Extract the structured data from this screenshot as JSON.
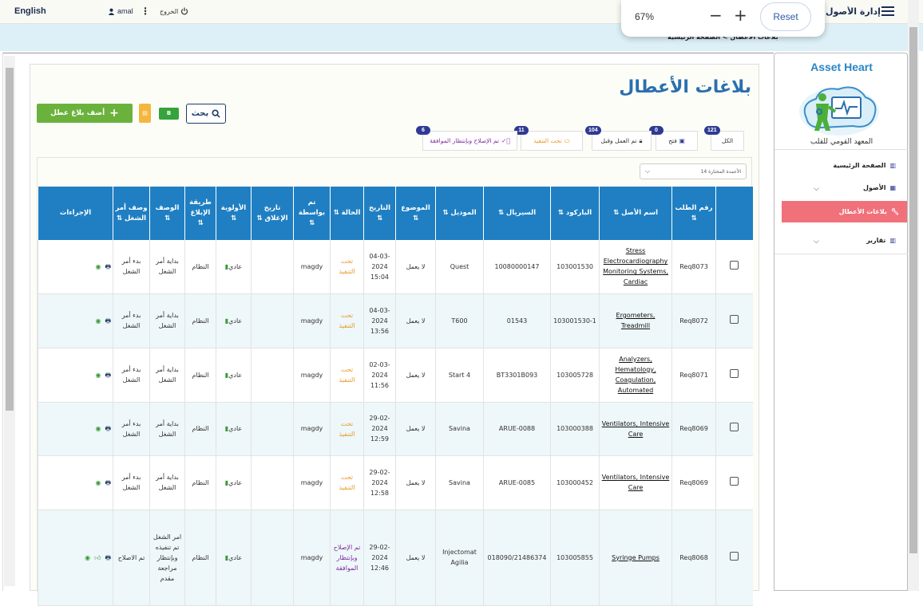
{
  "topbar": {
    "language": "English",
    "user": "amal",
    "logout": "الخروج",
    "system_name": "نظام إدارة الأصول"
  },
  "zoom": {
    "level": "67%",
    "reset": "Reset"
  },
  "breadcrumb": {
    "home": "الصفحة الرئيسية",
    "sep": ">",
    "current": "بلاغات الأعطال"
  },
  "page": {
    "title": "بلاغات الأعطال",
    "add_button": "أضف بلاغ عطل",
    "pdf_button": "",
    "excel_button": "B",
    "search_button": "بحث"
  },
  "filters": [
    {
      "label": "الكل",
      "count": "121"
    },
    {
      "label": "فتح",
      "count": "0"
    },
    {
      "label": "تم العمل وقبل",
      "count": "104"
    },
    {
      "label": "تحت التنفيذ",
      "count": "11"
    },
    {
      "label": "تم الإصلاح وبإنتظار الموافقة",
      "count": "6"
    }
  ],
  "column_selector": "14 الأعمدة المختارة",
  "table": {
    "headers": [
      "رقم الطلب ⇅",
      "اسم الأصل ⇅",
      "الباركود ⇅",
      "السيريال ⇅",
      "الموديل ⇅",
      "الموضوع ⇅",
      "التاريخ ⇅",
      "الحالة ⇅",
      "تم بواسطة ⇅",
      "تاريخ الإغلاق ⇅",
      "الأولوية ⇅",
      "طريقة الإبلاغ ⇅",
      "الوصف ⇅",
      "وصف أمر الشغل ⇅",
      "الإجراءات"
    ],
    "rows": [
      {
        "req": "Req8073",
        "asset": "Stress Electrocardiography Monitoring Systems, Cardiac",
        "barcode": "103001530",
        "serial": "10080000147",
        "model": "Quest",
        "subject": "لا يعمل",
        "date": "04-03-2024 15:04",
        "status": "تحت التنفيذ",
        "by": "magdy",
        "closed": "",
        "priority": "عادي",
        "method": "النظام",
        "desc": "بداية أمر الشغل",
        "wo_desc": "بدء أمر الشغل"
      },
      {
        "req": "Req8072",
        "asset": "Ergometers, Treadmill",
        "barcode": "103001530-1",
        "serial": "01543",
        "model": "T600",
        "subject": "لا يعمل",
        "date": "04-03-2024 13:56",
        "status": "تحت التنفيذ",
        "by": "magdy",
        "closed": "",
        "priority": "عادي",
        "method": "النظام",
        "desc": "بداية أمر الشغل",
        "wo_desc": "بدء أمر الشغل"
      },
      {
        "req": "Req8071",
        "asset": "Analyzers, Hematology, Coagulation, Automated",
        "barcode": "103005728",
        "serial": "BT3301B093",
        "model": "Start 4",
        "subject": "لا يعمل",
        "date": "02-03-2024 11:56",
        "status": "تحت التنفيذ",
        "by": "magdy",
        "closed": "",
        "priority": "عادي",
        "method": "النظام",
        "desc": "بداية أمر الشغل",
        "wo_desc": "بدء أمر الشغل"
      },
      {
        "req": "Req8069",
        "asset": "Ventilators, Intensive Care",
        "barcode": "103000388",
        "serial": "ARUE-0088",
        "model": "Savina",
        "subject": "لا يعمل",
        "date": "29-02-2024 12:59",
        "status": "تحت التنفيذ",
        "by": "magdy",
        "closed": "",
        "priority": "عادي",
        "method": "النظام",
        "desc": "بداية أمر الشغل",
        "wo_desc": "بدء أمر الشغل"
      },
      {
        "req": "Req8069",
        "asset": "Ventilators, Intensive Care",
        "barcode": "103000452",
        "serial": "ARUE-0085",
        "model": "Savina",
        "subject": "لا يعمل",
        "date": "29-02-2024 12:58",
        "status": "تحت التنفيذ",
        "by": "magdy",
        "closed": "",
        "priority": "عادي",
        "method": "النظام",
        "desc": "بداية أمر الشغل",
        "wo_desc": "بدء أمر الشغل"
      },
      {
        "req": "Req8068",
        "asset": "Syringe Pumps",
        "barcode": "103005855",
        "serial": "018090/21486374",
        "model": "Injectomat Agilia",
        "subject": "لا يعمل",
        "date": "29-02-2024 12:46",
        "status": "تم الإصلاح وبإنتظار الموافقة",
        "by": "magdy",
        "closed": "",
        "priority": "عادي",
        "method": "النظام",
        "desc": "امر الشغل تم تنفيذه وبإنتظار مراجعة مقدم",
        "wo_desc": "تم الاصلاح"
      }
    ]
  },
  "sidebar": {
    "brand": "Asset Heart",
    "institute": "المعهد القومي للقلب",
    "items": [
      {
        "label": "الصفحة الرئيسية"
      },
      {
        "label": "الأصول"
      },
      {
        "label": "بلاغات الأعطال"
      },
      {
        "label": "تقارير"
      }
    ]
  },
  "colors": {
    "accent": "#1f7fc2",
    "active": "#f1717b",
    "add": "#6bb23d",
    "badge": "#2f3a94"
  }
}
